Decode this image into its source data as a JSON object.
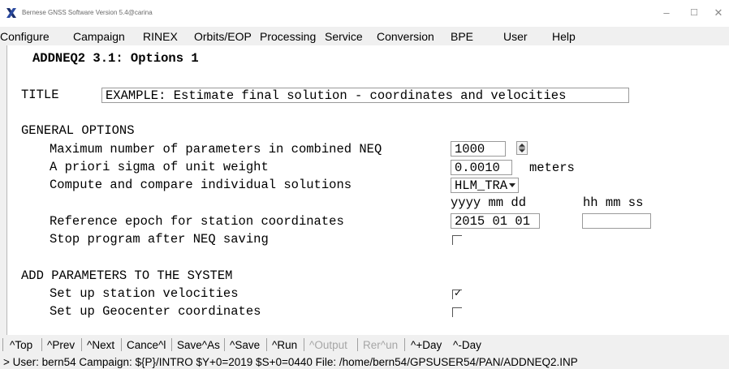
{
  "window": {
    "title": "Bernese GNSS Software Version 5.4@carina",
    "minimize_glyph": "–",
    "maximize_glyph": "☐",
    "close_glyph": "✕",
    "app_icon": "x-logo-icon"
  },
  "menu": {
    "items": [
      {
        "label": "Configure"
      },
      {
        "label": "Campaign"
      },
      {
        "label": "RINEX"
      },
      {
        "label": "Orbits/EOP"
      },
      {
        "label": "Processing"
      },
      {
        "label": "Service"
      },
      {
        "label": "Conversion"
      },
      {
        "label": "BPE"
      },
      {
        "label": "User"
      },
      {
        "label": "Help"
      }
    ]
  },
  "form": {
    "header": "ADDNEQ2 3.1: Options 1",
    "title_label": "TITLE",
    "title_value": "EXAMPLE: Estimate final solution - coordinates and velocities",
    "general_section": "GENERAL OPTIONS",
    "max_params_label": "Maximum number of parameters in combined NEQ",
    "max_params_value": "1000",
    "sigma_label": "A priori sigma of unit weight",
    "sigma_value": "0.0010",
    "sigma_unit": "meters",
    "compare_label": "Compute and compare individual solutions",
    "compare_value": "HLM_TRA",
    "date_format": "yyyy mm dd",
    "time_format": "hh mm ss",
    "epoch_label": "Reference epoch for station coordinates",
    "epoch_date": "2015 01 01",
    "epoch_time": "",
    "stop_label": "Stop program after NEQ saving",
    "stop_checked": false,
    "add_section": "ADD PARAMETERS TO THE SYSTEM",
    "velocities_label": "Set up station velocities",
    "velocities_checked": true,
    "geocenter_label": "Set up Geocenter coordinates",
    "geocenter_checked": false
  },
  "toolbar": {
    "top": "^Top",
    "prev": "^Prev",
    "next": "^Next",
    "cancel": "Cance^l",
    "save_as": "Save^As",
    "save": "^Save",
    "run": "^Run",
    "output": "^Output",
    "rerun": "Rer^un",
    "plus_day": "^+Day",
    "minus_day": "^-Day"
  },
  "status": {
    "text": "> User: bern54  Campaign: ${P}/INTRO  $Y+0=2019  $S+0=0440  File: /home/bern54/GPSUSER54/PAN/ADDNEQ2.INP"
  }
}
